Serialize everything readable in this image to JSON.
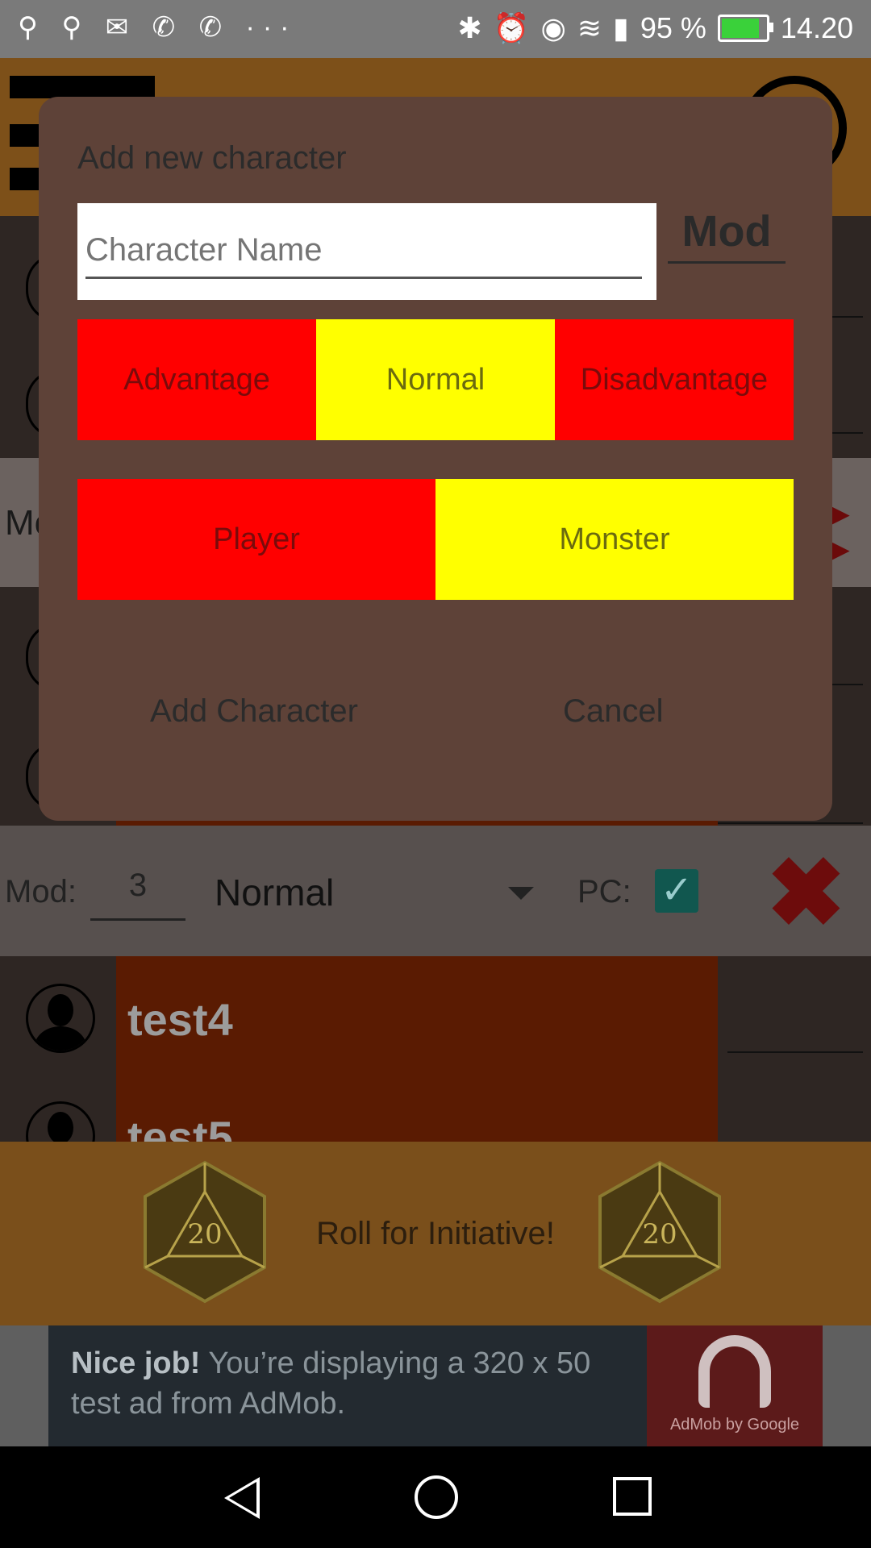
{
  "status_bar": {
    "left_icons": "⚲ ⚲ ✉ ✆ ✆ ···",
    "battery_percent": "95 %",
    "time": "14.20",
    "battery_level": 0.95
  },
  "background_list": {
    "partial_label": "Mo",
    "rows_below": [
      {
        "name": "test4"
      },
      {
        "name": "test5"
      }
    ]
  },
  "controls": {
    "mod_label": "Mod:",
    "mod_value": "3",
    "roll_mode": "Normal",
    "pc_label": "PC:",
    "pc_checked": true,
    "pc_check_glyph": "✓",
    "delete_glyph": "✖"
  },
  "dialog": {
    "title": "Add new character",
    "name_placeholder": "Character Name",
    "mod_placeholder": "Mod",
    "advantage_options": [
      "Advantage",
      "Normal",
      "Disadvantage"
    ],
    "advantage_selected": "Normal",
    "type_options": [
      "Player",
      "Monster"
    ],
    "type_selected": "Monster",
    "add_button": "Add Character",
    "cancel_button": "Cancel"
  },
  "roll_bar": {
    "label": "Roll for Initiative!",
    "die_face": "20"
  },
  "ad": {
    "headline": "Nice job!",
    "body": "You’re displaying a 320 x 50 test ad from AdMob.",
    "brand": "AdMob by Google"
  },
  "colors": {
    "accent_red": "#ff0000",
    "accent_yellow": "#ffff00",
    "app_orange": "#c88a2c",
    "dialog_bg": "#5e4238"
  }
}
